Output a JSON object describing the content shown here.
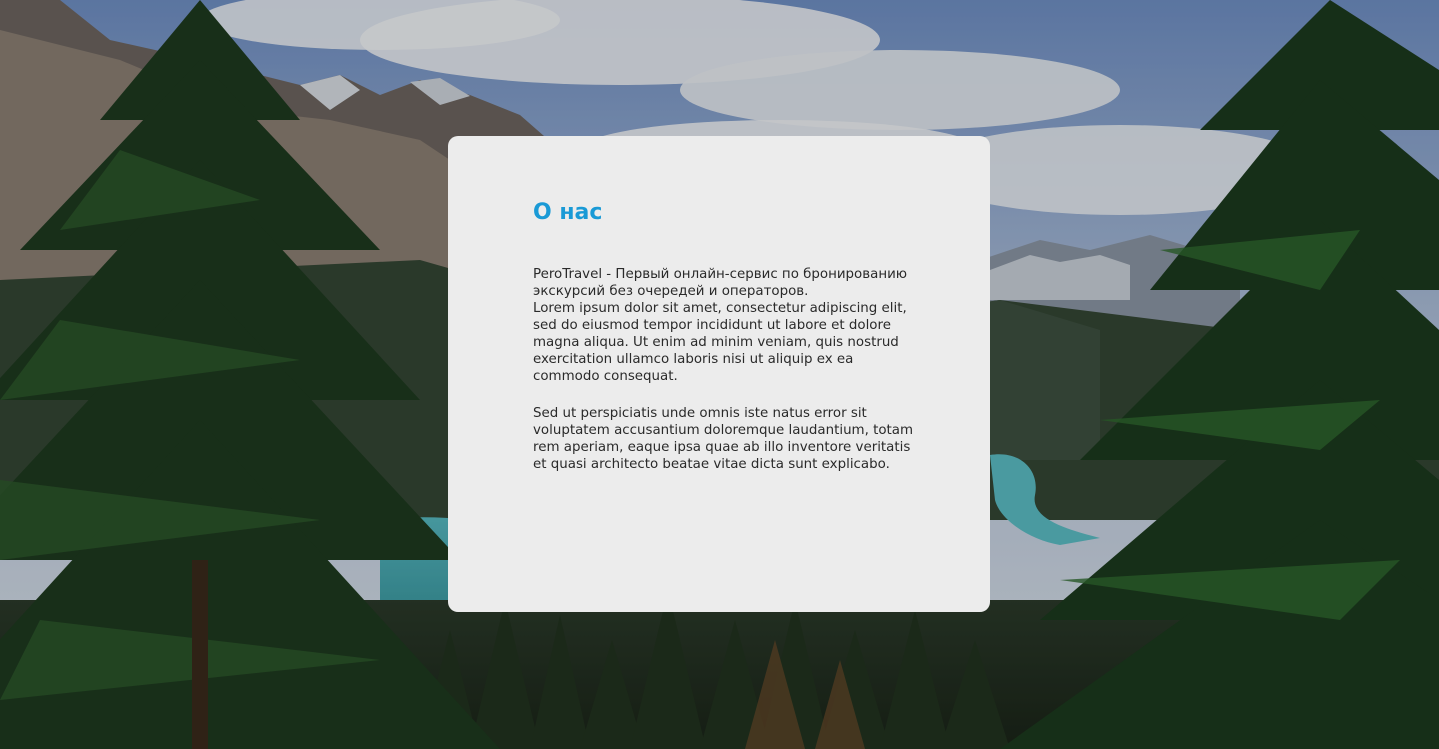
{
  "about": {
    "title": "О нас",
    "paragraph_1": "PeroTravel - Первый онлайн-сервис по бронированию экскурсий без очередей и операторов.\nLorem ipsum dolor sit amet, consectetur adipiscing elit, sed do eiusmod tempor incididunt ut labore et dolore magna aliqua. Ut enim ad minim veniam, quis nostrud exercitation ullamco laboris nisi ut aliquip ex ea commodo consequat.",
    "paragraph_2": "Sed ut perspiciatis unde omnis iste natus error sit voluptatem accusantium doloremque laudantium, totam rem aperiam, eaque ipsa quae ab illo inventore veritatis et quasi architecto beatae vitae dicta sunt explicabo."
  },
  "colors": {
    "accent": "#1a9ad6",
    "card_background": "#ececec",
    "text": "#2a2a2a"
  }
}
